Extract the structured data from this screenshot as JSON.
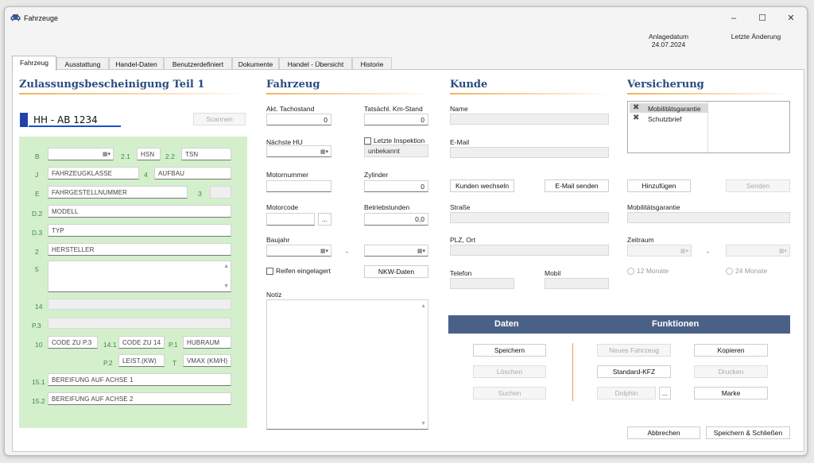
{
  "window": {
    "title": "Fahrzeuge",
    "minimize": "–",
    "maximize": "☐",
    "close": "✕"
  },
  "meta": {
    "anlage_label": "Anlagedatum",
    "anlage_value": "24.07.2024",
    "aenderung_label": "Letzte Änderung"
  },
  "tabs": [
    "Fahrzeug",
    "Ausstattung",
    "Handel-Daten",
    "Benutzerdefiniert",
    "Dokumente",
    "Handel - Übersicht",
    "Historie"
  ],
  "zb1": {
    "title": "Zulassungsbescheinigung Teil 1",
    "plate": "HH - AB 1234",
    "scan": "Scannen",
    "codes": {
      "b": "B",
      "c21": "2.1",
      "c22": "2.2",
      "j": "J",
      "c4": "4",
      "e": "E",
      "c3": "3",
      "d2": "D.2",
      "d3": "D.3",
      "c2": "2",
      "c5": "5",
      "c14": "14",
      "p3": "P.3",
      "c10": "10",
      "c141": "14.1",
      "p1": "P.1",
      "p2": "P.2",
      "t": "T",
      "c151": "15.1",
      "c152": "15.2"
    },
    "fields": {
      "hsn": "HSN",
      "tsn": "TSN",
      "klasse": "FAHRZEUGKLASSE",
      "aufbau": "AUFBAU",
      "fin": "FAHRGESTELLNUMMER",
      "modell": "MODELL",
      "typ": "TYP",
      "hersteller": "HERSTELLER",
      "code_p3": "CODE ZU P.3",
      "code_14": "CODE ZU 14",
      "hubraum": "HUBRAUM",
      "leistung": "LEIST.(KW)",
      "vmax": "VMAX (KM/H)",
      "achse1": "BEREIFUNG AUF ACHSE 1",
      "achse2": "BEREIFUNG AUF ACHSE 2"
    }
  },
  "fahrzeug": {
    "title": "Fahrzeug",
    "tacho_label": "Akt. Tachostand",
    "tacho_value": "0",
    "km_label": "Tatsächl. Km-Stand",
    "km_value": "0",
    "hu_label": "Nächste HU",
    "inspektion_label": "Letzte Inspektion",
    "inspektion_value": "unbekannt",
    "motornr_label": "Motornummer",
    "zylinder_label": "Zylinder",
    "zylinder_value": "0",
    "motorcode_label": "Motorcode",
    "ellipsis": "...",
    "betrieb_label": "Betriebstunden",
    "betrieb_value": "0,0",
    "baujahr_label": "Baujahr",
    "dash": "-",
    "reifen_label": "Reifen eingelagert",
    "nkw": "NKW-Daten",
    "notiz_label": "Notiz"
  },
  "kunde": {
    "title": "Kunde",
    "name_label": "Name",
    "email_label": "E-Mail",
    "wechseln": "Kunden wechseln",
    "email_send": "E-Mail senden",
    "strasse_label": "Straße",
    "plz_label": "PLZ, Ort",
    "telefon_label": "Telefon",
    "mobil_label": "Mobil"
  },
  "versicherung": {
    "title": "Versicherung",
    "items": [
      "Mobilitätsgarantie",
      "Schutzbrief"
    ],
    "hinzufuegen": "Hinzufügen",
    "senden": "Senden",
    "mobil_label": "Mobilitätsgarantie",
    "zeitraum_label": "Zeitraum",
    "dash": "-",
    "r12": "12 Monate",
    "r24": "24 Monate"
  },
  "actions": {
    "daten": "Daten",
    "funktionen": "Funktionen",
    "speichern": "Speichern",
    "loeschen": "Löschen",
    "suchen": "Suchen",
    "neues": "Neues Fahrzeug",
    "standard": "Standard-KFZ",
    "dolphin": "Dolphin",
    "ellipsis": "...",
    "kopieren": "Kopieren",
    "drucken": "Drucken",
    "marke": "Marke",
    "abbrechen": "Abbrechen",
    "speichern_schliessen": "Speichern & Schließen"
  },
  "colors": {
    "accent": "#4a6187",
    "section_title": "#2a4c80",
    "green_panel": "#d4efcc",
    "separator": "#e8a24a"
  }
}
